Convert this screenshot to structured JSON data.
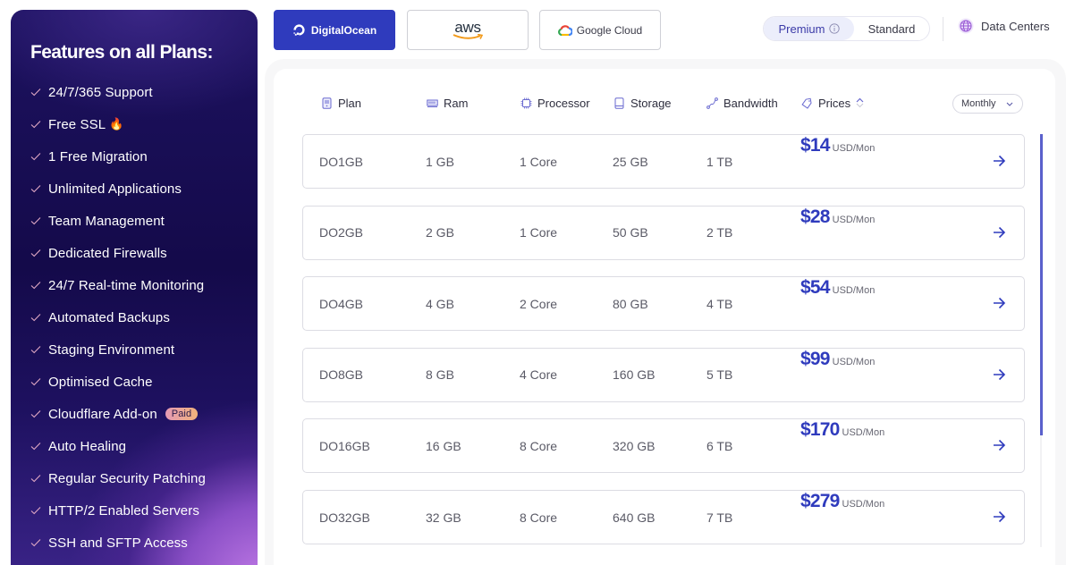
{
  "sidebar": {
    "title": "Features on all Plans:",
    "features": [
      {
        "label": "24/7/365 Support"
      },
      {
        "label": "Free SSL",
        "emoji": "🔥"
      },
      {
        "label": "1 Free Migration"
      },
      {
        "label": "Unlimited Applications"
      },
      {
        "label": "Team Management"
      },
      {
        "label": "Dedicated Firewalls"
      },
      {
        "label": "24/7 Real-time Monitoring"
      },
      {
        "label": "Automated Backups"
      },
      {
        "label": "Staging Environment"
      },
      {
        "label": "Optimised Cache"
      },
      {
        "label": "Cloudflare Add-on",
        "badge": "Paid"
      },
      {
        "label": "Auto Healing"
      },
      {
        "label": "Regular Security Patching"
      },
      {
        "label": "HTTP/2 Enabled Servers"
      },
      {
        "label": "SSH and SFTP Access"
      }
    ]
  },
  "providers": {
    "digitalocean": "DigitalOcean",
    "aws": "aws",
    "google": "Google Cloud",
    "active": "DigitalOcean"
  },
  "tier_toggle": {
    "premium": "Premium",
    "standard": "Standard",
    "selected": "Premium"
  },
  "data_centers_label": "Data Centers",
  "table": {
    "columns": {
      "plan": "Plan",
      "ram": "Ram",
      "processor": "Processor",
      "storage": "Storage",
      "bandwidth": "Bandwidth",
      "prices": "Prices"
    },
    "billing_period": "Monthly",
    "price_unit": "USD/Mon",
    "rows": [
      {
        "plan": "DO1GB",
        "ram": "1 GB",
        "processor": "1 Core",
        "storage": "25 GB",
        "bandwidth": "1 TB",
        "price": "$14"
      },
      {
        "plan": "DO2GB",
        "ram": "2 GB",
        "processor": "1 Core",
        "storage": "50 GB",
        "bandwidth": "2 TB",
        "price": "$28"
      },
      {
        "plan": "DO4GB",
        "ram": "4 GB",
        "processor": "2 Core",
        "storage": "80 GB",
        "bandwidth": "4 TB",
        "price": "$54"
      },
      {
        "plan": "DO8GB",
        "ram": "8 GB",
        "processor": "4 Core",
        "storage": "160 GB",
        "bandwidth": "5 TB",
        "price": "$99"
      },
      {
        "plan": "DO16GB",
        "ram": "16 GB",
        "processor": "8 Core",
        "storage": "320 GB",
        "bandwidth": "6 TB",
        "price": "$170"
      },
      {
        "plan": "DO32GB",
        "ram": "32 GB",
        "processor": "8 Core",
        "storage": "640 GB",
        "bandwidth": "7 TB",
        "price": "$279"
      }
    ]
  },
  "colors": {
    "accent": "#2f3bbd",
    "sidebar_bg": "#140a4a",
    "scroll_thumb": "#5a60cc"
  }
}
